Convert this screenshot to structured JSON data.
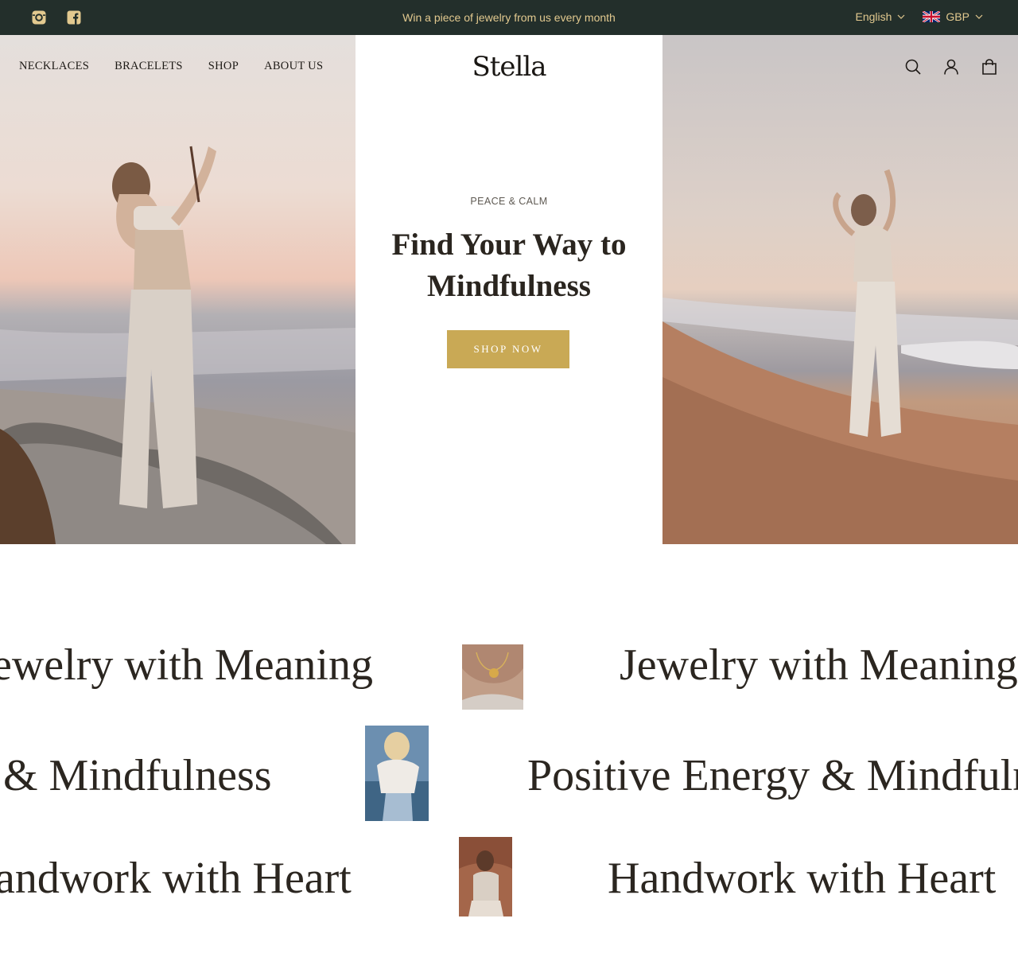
{
  "topbar": {
    "social": [
      "instagram-icon",
      "facebook-icon"
    ],
    "announcement": "Win a piece of jewelry from us every month",
    "language": "English",
    "currency": "GBP",
    "colors": {
      "background": "#232f2b",
      "text": "#e2c98f"
    }
  },
  "nav": {
    "items": [
      {
        "label": "NECKLACES"
      },
      {
        "label": "BRACELETS"
      },
      {
        "label": "SHOP"
      },
      {
        "label": "ABOUT US"
      }
    ]
  },
  "header": {
    "logo": "Stella",
    "icons": [
      "search-icon",
      "account-icon",
      "cart-icon"
    ]
  },
  "hero": {
    "eyebrow": "PEACE & CALM",
    "headline_line1": "Find Your Way to",
    "headline_line2": "Mindfulness",
    "cta": "SHOP NOW",
    "colors": {
      "cta": "#c9a955"
    }
  },
  "marquee": {
    "lines": [
      {
        "text": "Jewelry with Meaning",
        "partial": "ewelry with Meaning"
      },
      {
        "text": "Positive Energy & Mindfulness",
        "partial": "& Mindfulness"
      },
      {
        "text": "Handwork with Heart",
        "partial": "andwork with Heart"
      }
    ]
  }
}
